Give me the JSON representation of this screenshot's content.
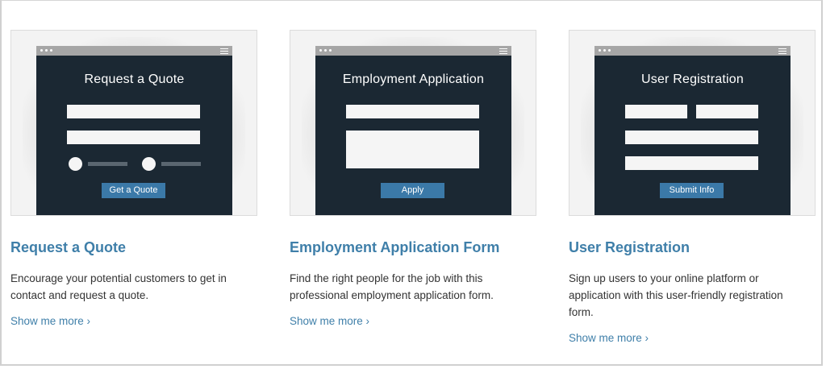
{
  "cards": [
    {
      "form_title": "Request a Quote",
      "button_label": "Get a Quote",
      "title": "Request a Quote",
      "description": "Encourage your potential customers to get in contact and request a quote.",
      "link": "Show me more ›"
    },
    {
      "form_title": "Employment Application",
      "button_label": "Apply",
      "title": "Employment Application Form",
      "description": "Find the right people for the job with this professional employment application form.",
      "link": "Show me more ›"
    },
    {
      "form_title": "User Registration",
      "button_label": "Submit Info",
      "title": "User Registration",
      "description": "Sign up users to your online platform or application with this user-friendly registration form.",
      "link": "Show me more ›"
    }
  ],
  "colors": {
    "accent": "#3f7fa9",
    "browser_bg": "#1b2833",
    "button": "#3b79a8"
  }
}
